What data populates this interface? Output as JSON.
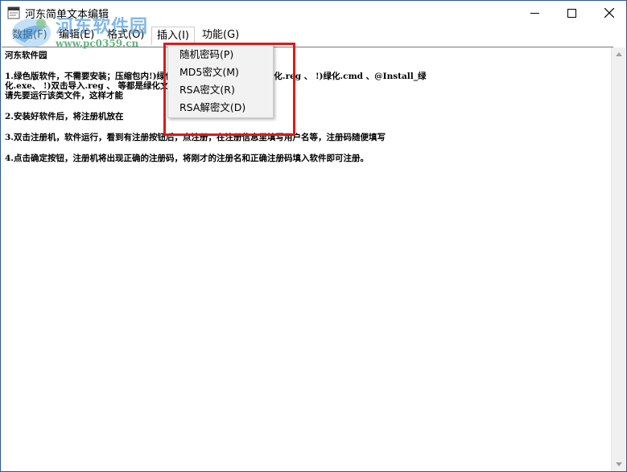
{
  "window": {
    "title": "河东简单文本编辑",
    "controls": {
      "minimize_icon": "minimize-icon",
      "maximize_icon": "maximize-icon",
      "close_icon": "close-icon"
    }
  },
  "watermark": {
    "name": "河东软件园",
    "url": "www.pc0359.cn"
  },
  "menu": {
    "items": [
      {
        "label": "数据(F)"
      },
      {
        "label": "编辑(E)"
      },
      {
        "label": "格式(O)"
      },
      {
        "label": "插入(I)",
        "active": true
      },
      {
        "label": "功能(G)"
      }
    ]
  },
  "dropdown": {
    "items": [
      {
        "label": "随机密码(P)"
      },
      {
        "label": "MD5密文(M)"
      },
      {
        "label": "RSA密文(R)"
      },
      {
        "label": "RSA解密文(D)"
      }
    ]
  },
  "editor": {
    "lines": [
      "河东软件园",
      "1.绿色版软件，不需要安装；压缩包内!)绿化.exe、!)绿化.bat 、 !)绿化.reg 、 !)绿化.cmd 、@Install_绿",
      "化.exe、 !)双击导入.reg 、 等都是绿化文件，",
      " 请先要运行该类文件，这样才能",
      "2.安装好软件后，将注册机放在",
      "3.双击注册机，软件运行，看到有注册按钮后，点注册，在注册信息里填写用户名等，注册码随便填写",
      "4.点击确定按钮，注册机将出现正确的注册码，将刚才的注册名和正确注册码填入软件即可注册。"
    ]
  },
  "colors": {
    "highlight_box": "#d71c1c",
    "dropdown_bg": "#f2f2f2",
    "window_border": "#2b5797"
  }
}
